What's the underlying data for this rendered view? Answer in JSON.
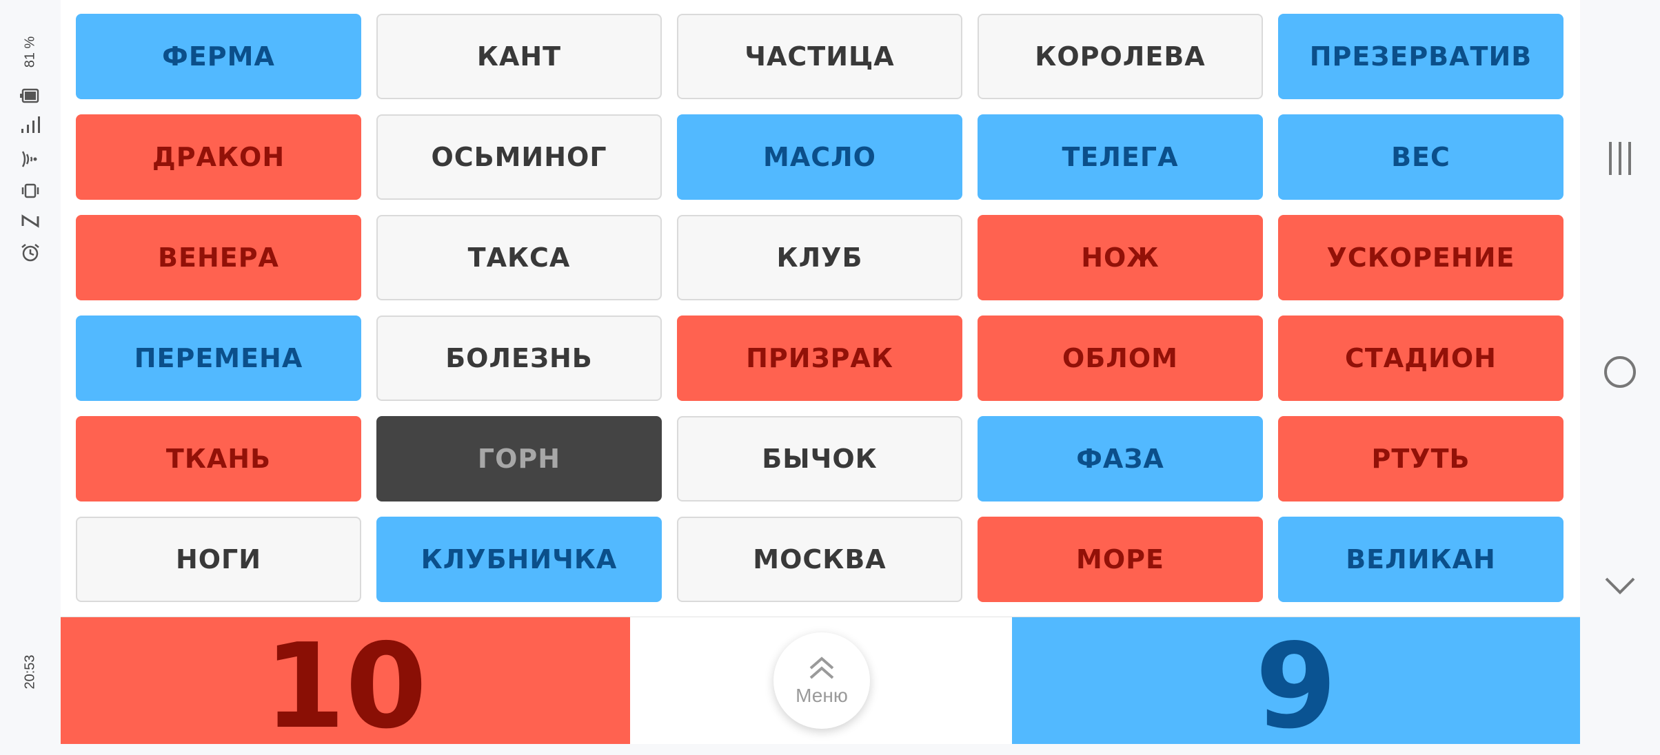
{
  "status_bar": {
    "battery": "81 %",
    "time": "20:53",
    "icons": [
      "battery-icon",
      "signal-icon",
      "wifi-icon",
      "vibrate-icon",
      "nfc-icon",
      "alarm-icon"
    ]
  },
  "board": {
    "cards": [
      {
        "word": "ФЕРМА",
        "team": "blue"
      },
      {
        "word": "КАНТ",
        "team": "neutral"
      },
      {
        "word": "ЧАСТИЦА",
        "team": "neutral"
      },
      {
        "word": "КОРОЛЕВА",
        "team": "neutral"
      },
      {
        "word": "ПРЕЗЕРВАТИВ",
        "team": "blue"
      },
      {
        "word": "ДРАКОН",
        "team": "red"
      },
      {
        "word": "ОСЬМИНОГ",
        "team": "neutral"
      },
      {
        "word": "МАСЛО",
        "team": "blue"
      },
      {
        "word": "ТЕЛЕГА",
        "team": "blue"
      },
      {
        "word": "ВЕС",
        "team": "blue"
      },
      {
        "word": "ВЕНЕРА",
        "team": "red"
      },
      {
        "word": "ТАКСА",
        "team": "neutral"
      },
      {
        "word": "КЛУБ",
        "team": "neutral"
      },
      {
        "word": "НОЖ",
        "team": "red"
      },
      {
        "word": "УСКОРЕНИЕ",
        "team": "red"
      },
      {
        "word": "ПЕРЕМЕНА",
        "team": "blue"
      },
      {
        "word": "БОЛЕЗНЬ",
        "team": "neutral"
      },
      {
        "word": "ПРИЗРАК",
        "team": "red"
      },
      {
        "word": "ОБЛОМ",
        "team": "red"
      },
      {
        "word": "СТАДИОН",
        "team": "red"
      },
      {
        "word": "ТКАНЬ",
        "team": "red"
      },
      {
        "word": "ГОРН",
        "team": "black"
      },
      {
        "word": "БЫЧОК",
        "team": "neutral"
      },
      {
        "word": "ФАЗА",
        "team": "blue"
      },
      {
        "word": "РТУТЬ",
        "team": "red"
      },
      {
        "word": "НОГИ",
        "team": "neutral"
      },
      {
        "word": "КЛУБНИЧКА",
        "team": "blue"
      },
      {
        "word": "МОСКВА",
        "team": "neutral"
      },
      {
        "word": "МОРЕ",
        "team": "red"
      },
      {
        "word": "ВЕЛИКАН",
        "team": "blue"
      }
    ]
  },
  "score": {
    "red": "10",
    "blue": "9"
  },
  "menu": {
    "label": "Меню",
    "icon": "double-chevron-up-icon"
  },
  "nav": {
    "icons": [
      "recent-apps-icon",
      "home-icon",
      "back-chevron-icon"
    ]
  },
  "colors": {
    "blue": "#52b9ff",
    "red": "#ff6250",
    "neutral": "#f7f7f7",
    "black": "#444444",
    "blue_text": "#0b4f8a",
    "red_text": "#921108"
  }
}
